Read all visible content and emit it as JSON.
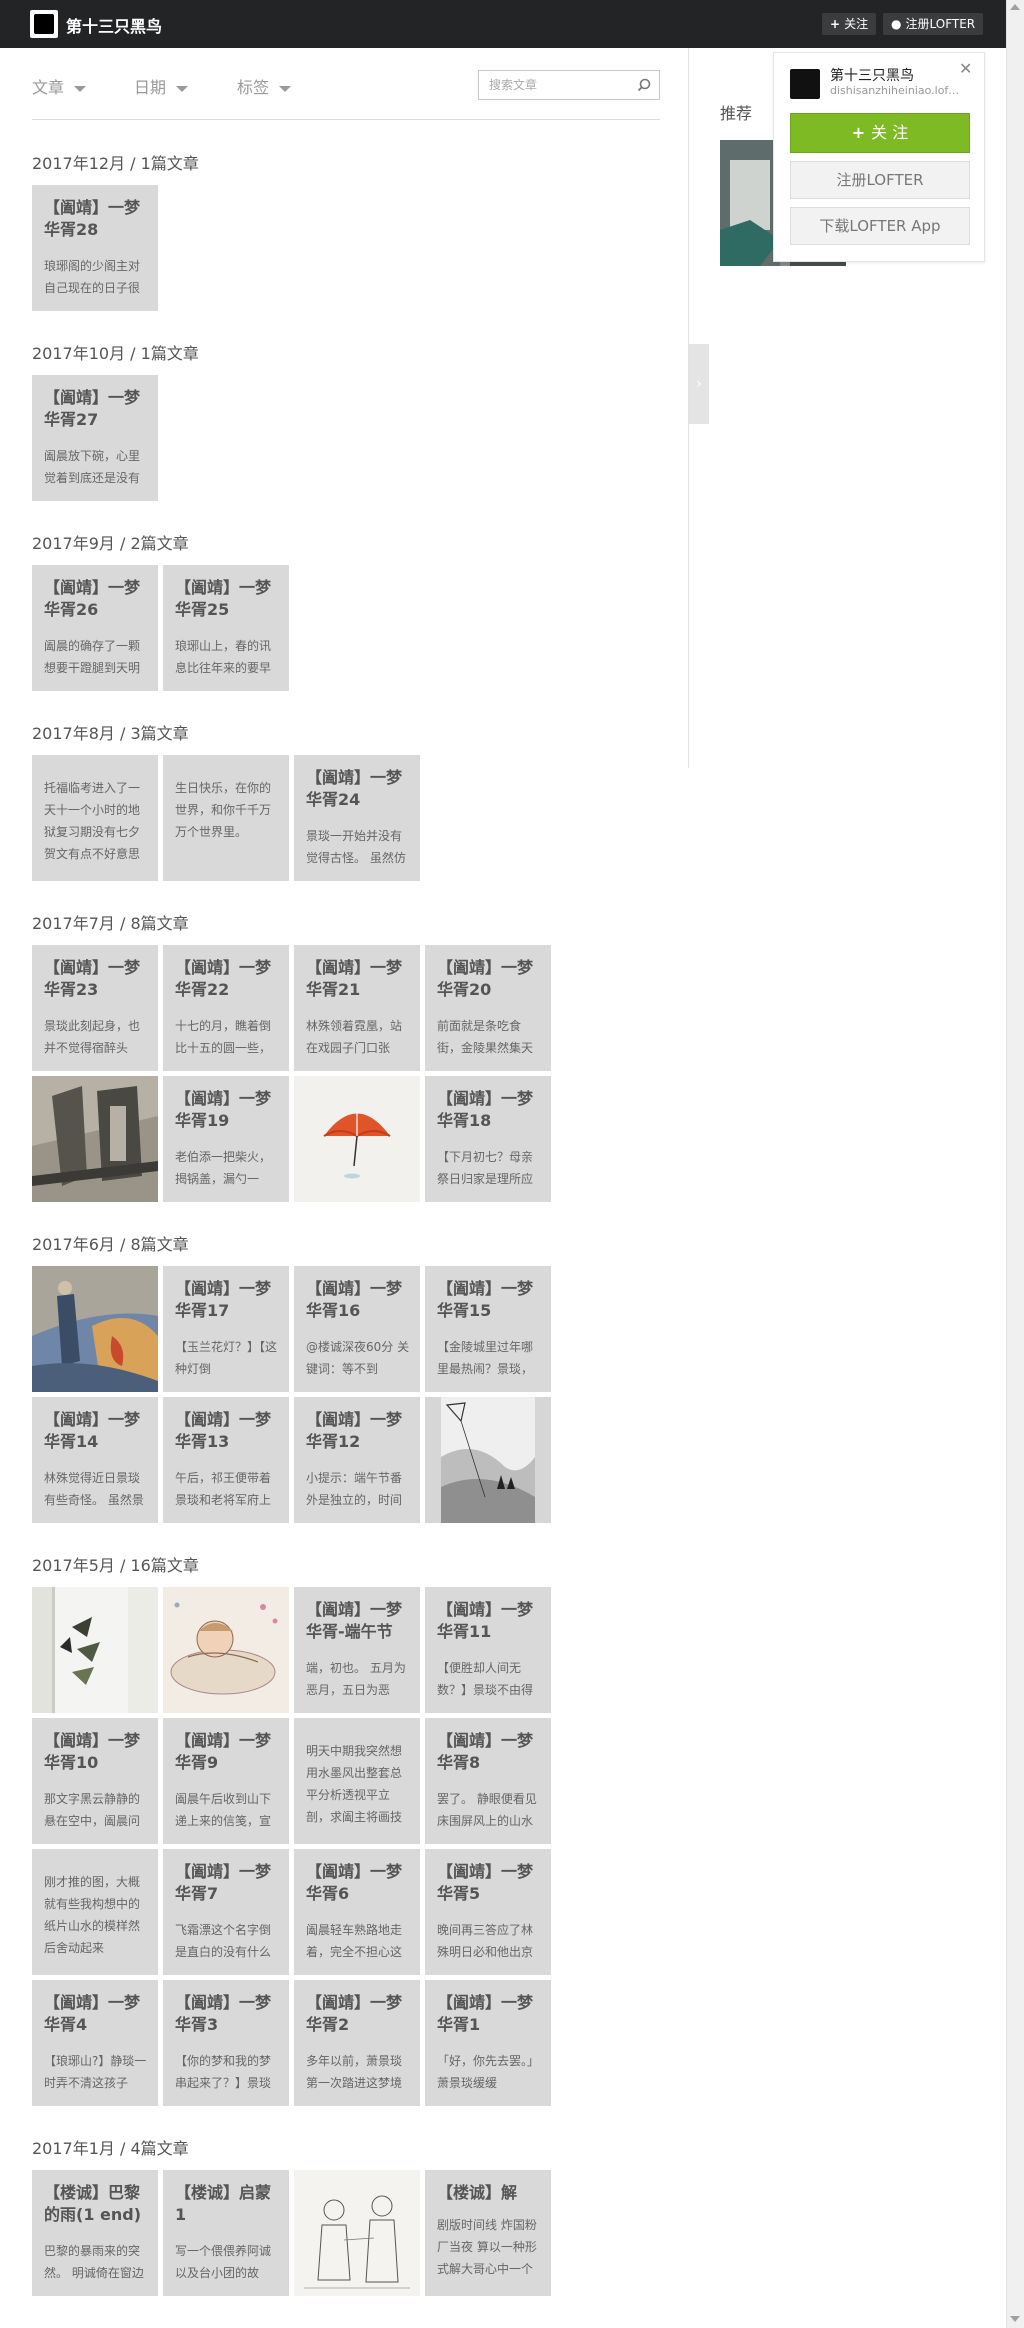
{
  "topbar": {
    "blog_name": "第十三只黑鸟",
    "follow_label": "关注",
    "register_label": "注册LOFTER"
  },
  "filters": {
    "articles": "文章",
    "date": "日期",
    "tags": "标签",
    "search_placeholder": "搜索文章"
  },
  "sidebar": {
    "recommend_title": "推荐"
  },
  "popup": {
    "name": "第十三只黑鸟",
    "domain": "dishisanzhiheiniao.lofter.com",
    "follow_label": "关 注",
    "register_label": "注册LOFTER",
    "app_label": "下载LOFTER App"
  },
  "months": [
    {
      "heading": "2017年12月 / 1篇文章"
    },
    {
      "heading": "2017年10月 / 1篇文章"
    },
    {
      "heading": "2017年9月 / 2篇文章"
    },
    {
      "heading": "2017年8月 / 3篇文章"
    },
    {
      "heading": "2017年7月 / 8篇文章"
    },
    {
      "heading": "2017年6月 / 8篇文章"
    },
    {
      "heading": "2017年5月 / 16篇文章"
    },
    {
      "heading": "2017年1月 / 4篇文章"
    }
  ],
  "cards": {
    "c1": {
      "title": "【阖靖】一梦华胥28",
      "excerpt": "琅琊阁的少阁主对自己现在的日子很"
    },
    "c2": {
      "title": "【阖靖】一梦华胥27",
      "excerpt": "阖晨放下碗，心里觉着到底还是没有"
    },
    "c3": {
      "title": "【阖靖】一梦华胥26",
      "excerpt": "阖晨的确存了一颗想要干蹬腿到天明"
    },
    "c4": {
      "title": "【阖靖】一梦华胥25",
      "excerpt": "琅琊山上，春的讯息比往年来的要早"
    },
    "c5": {
      "excerpt": "托福临考进入了一天十一个小时的地狱复习期没有七夕贺文有点不好意思"
    },
    "c6": {
      "excerpt": "生日快乐，在你的世界，和你千千万万个世界里。"
    },
    "c7": {
      "title": "【阖靖】一梦华胥24",
      "excerpt": "景琰一开始并没有觉得古怪。 虽然仿"
    },
    "c8": {
      "title": "【阖靖】一梦华胥23",
      "excerpt": "景琰此刻起身，也并不觉得宿醉头"
    },
    "c9": {
      "title": "【阖靖】一梦华胥22",
      "excerpt": "十七的月，瞧着倒比十五的圆一些，"
    },
    "c10": {
      "title": "【阖靖】一梦华胥21",
      "excerpt": "林殊领着霓凰，站在戏园子门口张"
    },
    "c11": {
      "title": "【阖靖】一梦华胥20",
      "excerpt": "前面就是条吃食街，金陵果然集天"
    },
    "c13": {
      "title": "【阖靖】一梦华胥19",
      "excerpt": "老伯添一把柴火，揭锅盖，漏勺一"
    },
    "c15": {
      "title": "【阖靖】一梦华胥18",
      "excerpt": "【下月初七？母亲祭日归家是理所应"
    },
    "c17": {
      "title": "【阖靖】一梦华胥17",
      "excerpt": "【玉兰花灯？】【这种灯倒"
    },
    "c18": {
      "title": "【阖靖】一梦华胥16",
      "excerpt": "@楼诚深夜60分 关键词：等不到"
    },
    "c19": {
      "title": "【阖靖】一梦华胥15",
      "excerpt": "【金陵城里过年哪里最热闹？景琰，"
    },
    "c20": {
      "title": "【阖靖】一梦华胥14",
      "excerpt": "林殊觉得近日景琰有些奇怪。 虽然景"
    },
    "c21": {
      "title": "【阖靖】一梦华胥13",
      "excerpt": "午后，祁王便带着景琰和老将军府上"
    },
    "c22": {
      "title": "【阖靖】一梦华胥12",
      "excerpt": "小提示：端午节番外是独立的，时间"
    },
    "c26": {
      "title": "【阖靖】一梦华胥-端午节",
      "excerpt": "端，初也。 五月为恶月，五日为恶"
    },
    "c27": {
      "title": "【阖靖】一梦华胥11",
      "excerpt": "【便胜却人间无数？】景琰不由得"
    },
    "c28": {
      "title": "【阖靖】一梦华胥10",
      "excerpt": "那文字黑云静静的悬在空中，阖晨问"
    },
    "c29": {
      "title": "【阖靖】一梦华胥9",
      "excerpt": "阖晨午后收到山下递上来的信笺，宣"
    },
    "c30": {
      "excerpt": "明天中期我突然想用水墨风出整套总平分析透视平立剖，求阖主将画技"
    },
    "c31": {
      "title": "【阖靖】一梦华胥8",
      "excerpt": "罢了。 静眼便看见床围屏风上的山水"
    },
    "c32": {
      "excerpt": "刚才推的图，大概就有些我构想中的纸片山水的模样然后舍动起来"
    },
    "c33": {
      "title": "【阖靖】一梦华胥7",
      "excerpt": "飞霜漂这个名字倒是直白的没有什么"
    },
    "c34": {
      "title": "【阖靖】一梦华胥6",
      "excerpt": "阖晨轻车熟路地走着，完全不担心这"
    },
    "c35": {
      "title": "【阖靖】一梦华胥5",
      "excerpt": "晚间再三答应了林殊明日必和他出京"
    },
    "c36": {
      "title": "【阖靖】一梦华胥4",
      "excerpt": "【琅琊山?】静琰一时弄不清这孩子"
    },
    "c37": {
      "title": "【阖靖】一梦华胥3",
      "excerpt": "【你的梦和我的梦串起来了？】景琰"
    },
    "c38": {
      "title": "【阖靖】一梦华胥2",
      "excerpt": "多年以前，萧景琰第一次踏进这梦境"
    },
    "c39": {
      "title": "【阖靖】一梦华胥1",
      "excerpt": "「好，你先去罢。」萧景琰缓缓"
    },
    "c40": {
      "title": "【楼诚】巴黎的雨(1 end)",
      "excerpt": "巴黎的暴雨来的突然。 明诚倚在窗边"
    },
    "c41": {
      "title": "【楼诚】启蒙1",
      "excerpt": "写一个偎偎养阿诚以及台小团的故"
    },
    "c43": {
      "title": "【楼诚】解",
      "excerpt": "剧版时间线 炸国粉厂当夜 算以一种形式解大哥心中一个"
    }
  }
}
